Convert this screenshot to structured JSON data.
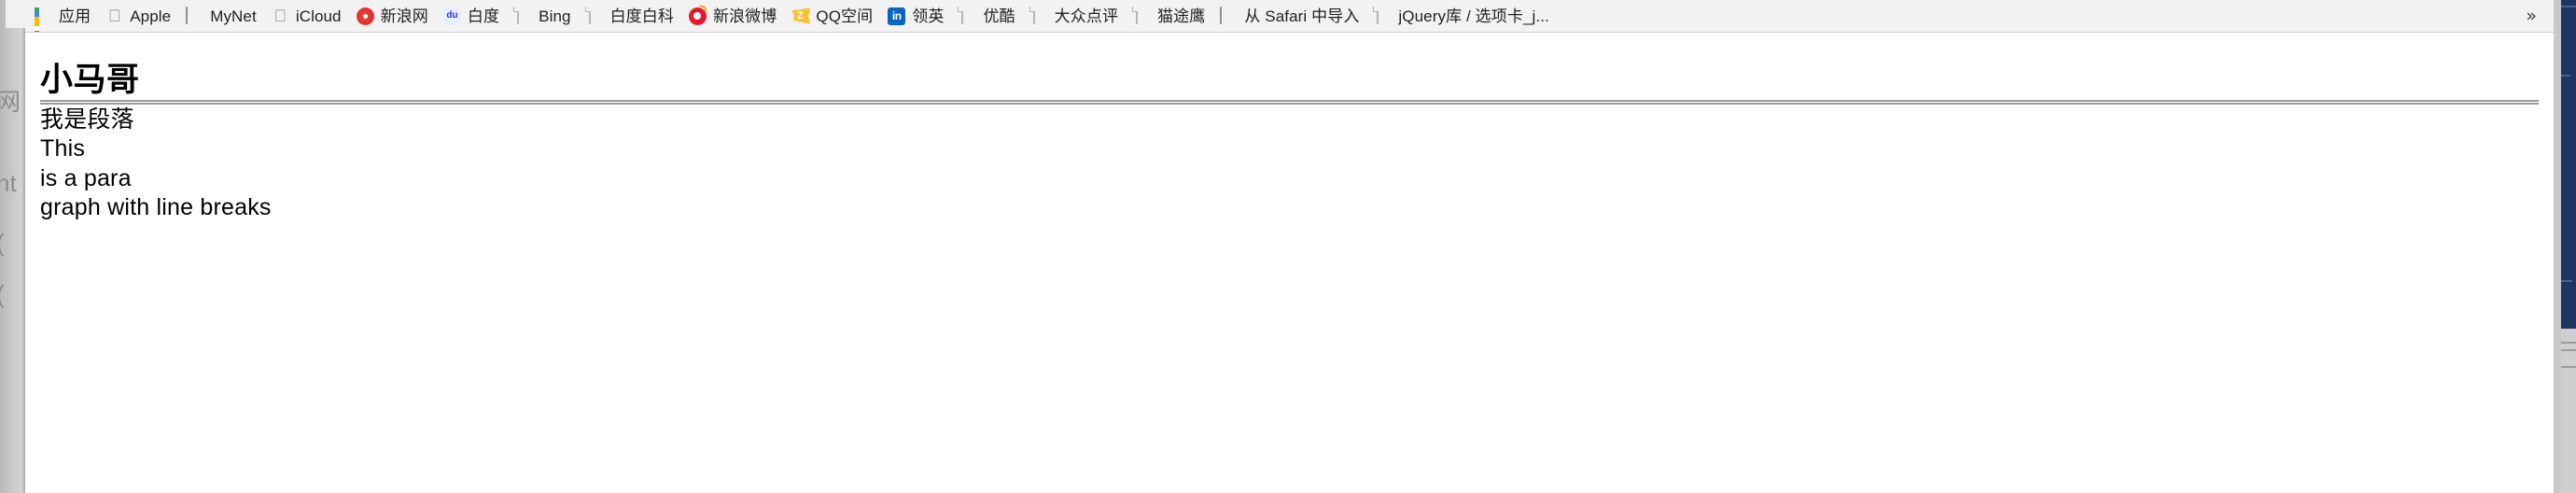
{
  "bookmarks_bar": {
    "items": [
      {
        "label": "应用",
        "icon": "apps-grid-icon"
      },
      {
        "label": "Apple",
        "icon": "apple-icon"
      },
      {
        "label": "MyNet",
        "icon": "window-icon"
      },
      {
        "label": "iCloud",
        "icon": "apple-icon"
      },
      {
        "label": "新浪网",
        "icon": "sina-icon"
      },
      {
        "label": "白度",
        "icon": "baidu-icon"
      },
      {
        "label": "Bing",
        "icon": "page-icon"
      },
      {
        "label": "白度白科",
        "icon": "page-icon"
      },
      {
        "label": "新浪微博",
        "icon": "weibo-icon"
      },
      {
        "label": "QQ空间",
        "icon": "qq-star-icon"
      },
      {
        "label": "领英",
        "icon": "linkedin-icon"
      },
      {
        "label": "优酷",
        "icon": "page-icon"
      },
      {
        "label": "大众点评",
        "icon": "page-icon"
      },
      {
        "label": "猫途鹰",
        "icon": "page-icon"
      },
      {
        "label": "从 Safari 中导入",
        "icon": "window-icon"
      },
      {
        "label": "jQuery库 / 选项卡_j...",
        "icon": "page-icon"
      }
    ],
    "overflow_label": "»"
  },
  "page": {
    "title": "小马哥",
    "paragraph_1": "我是段落",
    "paragraph_2_lines": [
      "This",
      "is a para",
      "graph with line breaks"
    ]
  },
  "background_windows": {
    "left_fragments": [
      "网",
      "nt",
      "(",
      "("
    ],
    "right_color": "#1e3461"
  },
  "colors": {
    "bookmark_bar_bg": "#f2f2f2",
    "bookmark_bar_border": "#cfcfcf",
    "text": "#1f1f1f",
    "rule": "#9a9a9a",
    "page_bg": "#ffffff"
  }
}
